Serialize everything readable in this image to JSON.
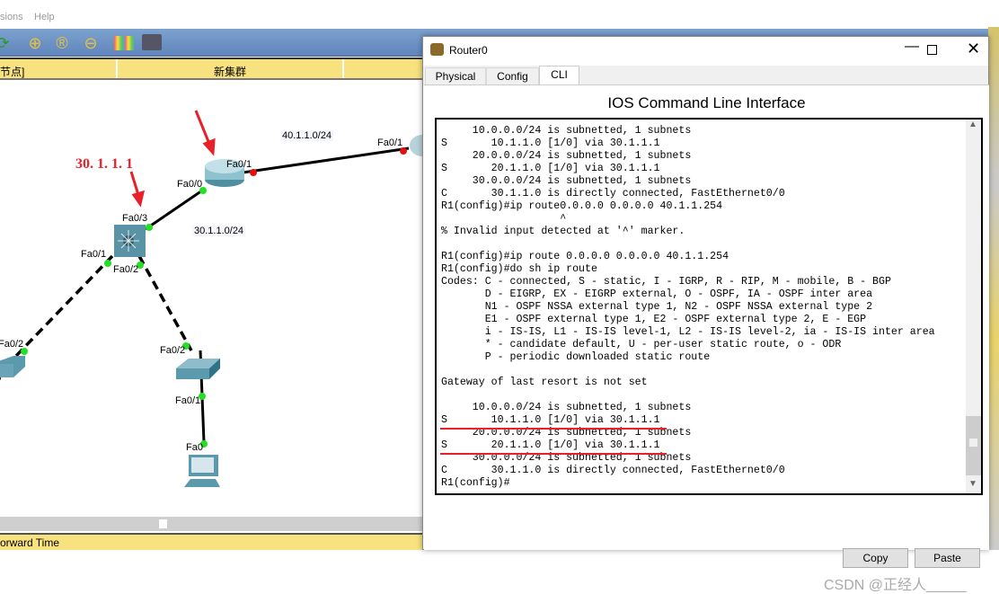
{
  "app": {
    "menu": [
      "sions",
      "Help"
    ],
    "toolbar_icons": [
      "undo-arrow-icon",
      "zoom-in-icon",
      "zoom-reset-icon",
      "zoom-out-icon",
      "palette-icon",
      "device-dialog-icon"
    ],
    "cluster_bar": {
      "left_label": "节点]",
      "center_label": "新集群"
    },
    "status_label": "orward Time"
  },
  "topology": {
    "annotation_ip": "30. 1. 1. 1",
    "networks": [
      "40.1.1.0/24",
      "30.1.1.0/24"
    ],
    "ports": {
      "router_fa01": "Fa0/1",
      "router_fa00": "Fa0/0",
      "remote_fa01": "Fa0/1",
      "ml_fa03": "Fa0/3",
      "ml_fa01": "Fa0/1",
      "ml_fa02": "Fa0/2",
      "swleft_fa02": "Fa0/2",
      "swright_fa02": "Fa0/2",
      "swright_fa01": "Fa0/1",
      "pc_fa0": "Fa0"
    }
  },
  "dialog": {
    "title": "Router0",
    "tabs": [
      "Physical",
      "Config",
      "CLI"
    ],
    "active_tab": "CLI",
    "heading": "IOS Command Line Interface",
    "terminal_lines": [
      "     10.0.0.0/24 is subnetted, 1 subnets",
      "S       10.1.1.0 [1/0] via 30.1.1.1",
      "     20.0.0.0/24 is subnetted, 1 subnets",
      "S       20.1.1.0 [1/0] via 30.1.1.1",
      "     30.0.0.0/24 is subnetted, 1 subnets",
      "C       30.1.1.0 is directly connected, FastEthernet0/0",
      "R1(config)#ip route0.0.0.0 0.0.0.0 40.1.1.254",
      "                   ^",
      "% Invalid input detected at '^' marker.",
      "",
      "R1(config)#ip route 0.0.0.0 0.0.0.0 40.1.1.254",
      "R1(config)#do sh ip route",
      "Codes: C - connected, S - static, I - IGRP, R - RIP, M - mobile, B - BGP",
      "       D - EIGRP, EX - EIGRP external, O - OSPF, IA - OSPF inter area",
      "       N1 - OSPF NSSA external type 1, N2 - OSPF NSSA external type 2",
      "       E1 - OSPF external type 1, E2 - OSPF external type 2, E - EGP",
      "       i - IS-IS, L1 - IS-IS level-1, L2 - IS-IS level-2, ia - IS-IS inter area",
      "       * - candidate default, U - per-user static route, o - ODR",
      "       P - periodic downloaded static route",
      "",
      "Gateway of last resort is not set",
      "",
      "     10.0.0.0/24 is subnetted, 1 subnets",
      "S       10.1.1.0 [1/0] via 30.1.1.1",
      "     20.0.0.0/24 is subnetted, 1 subnets",
      "S       20.1.1.0 [1/0] via 30.1.1.1",
      "     30.0.0.0/24 is subnetted, 1 subnets",
      "C       30.1.1.0 is directly connected, FastEthernet0/0",
      "R1(config)#"
    ],
    "copy_label": "Copy",
    "paste_label": "Paste",
    "scroll_position_percent": 95
  },
  "watermark": "CSDN @正经人_____",
  "colors": {
    "annotation": "#e8202a",
    "link_up": "#22e022",
    "link_down": "#e01010",
    "toolbar": "#6a8fc4",
    "cluster_bar": "#f7e27f"
  }
}
